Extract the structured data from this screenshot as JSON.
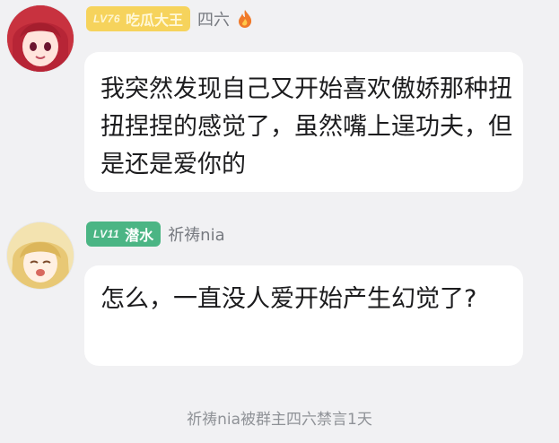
{
  "messages": [
    {
      "level_badge": "LV76",
      "title": "吃瓜大王",
      "nickname": "四六",
      "text": "我突然发现自己又开始喜欢傲娇那种扭扭捏捏的感觉了，虽然嘴上逞功夫，但是还是爱你的",
      "badge_color": "#f6d35c",
      "has_flame": true
    },
    {
      "level_badge": "LV11",
      "title": "潜水",
      "nickname": "祈祷nia",
      "text": "怎么，一直没人爱开始产生幻觉了?",
      "badge_color": "#4bb584",
      "has_flame": false
    }
  ],
  "system_notice": "祈祷nia被群主四六禁言1天",
  "icons": [
    "avatar",
    "flame-icon"
  ]
}
